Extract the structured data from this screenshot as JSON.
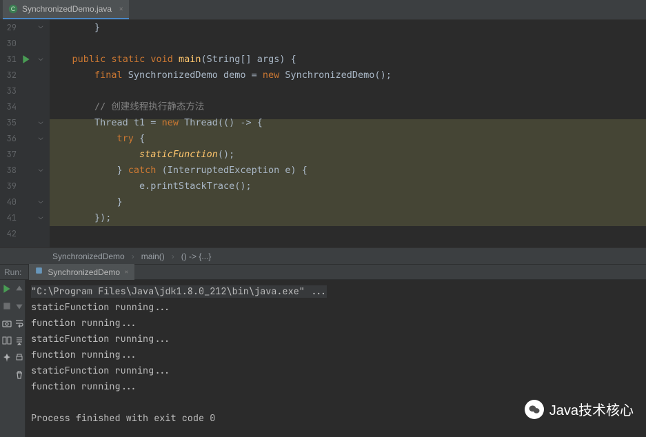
{
  "tab": {
    "filename": "SynchronizedDemo.java"
  },
  "gutter": {
    "start": 29,
    "end": 42
  },
  "code": {
    "29": "        }",
    "30": "",
    "31_a": "    ",
    "31_public": "public",
    "31_b": " ",
    "31_static": "static",
    "31_c": " ",
    "31_void": "void",
    "31_d": " ",
    "31_main": "main",
    "31_e": "(String[] args) {",
    "32_a": "        ",
    "32_final": "final",
    "32_b": " SynchronizedDemo demo = ",
    "32_new": "new",
    "32_c": " SynchronizedDemo();",
    "33": "",
    "34_a": "        ",
    "34_cm": "// 创建线程执行静态方法",
    "35_a": "        Thread t1 = ",
    "35_new": "new",
    "35_b": " Thread(() -> {",
    "36_a": "            ",
    "36_try": "try",
    "36_b": " {",
    "37_a": "                ",
    "37_fn": "staticFunction",
    "37_b": "();",
    "38_a": "            } ",
    "38_catch": "catch",
    "38_b": " (InterruptedException e) {",
    "39": "                e.printStackTrace();",
    "40": "            }",
    "41": "        });",
    "42": ""
  },
  "breadcrumbs": {
    "a": "SynchronizedDemo",
    "b": "main()",
    "c": "() -> {...}"
  },
  "run": {
    "label": "Run:",
    "config": "SynchronizedDemo",
    "lines": [
      "\"C:\\Program Files\\Java\\jdk1.8.0_212\\bin\\java.exe\" ...",
      "staticFunction running...",
      "function running...",
      "staticFunction running...",
      "function running...",
      "staticFunction running...",
      "function running...",
      "",
      "Process finished with exit code 0"
    ]
  },
  "watermark": "Java技术核心"
}
